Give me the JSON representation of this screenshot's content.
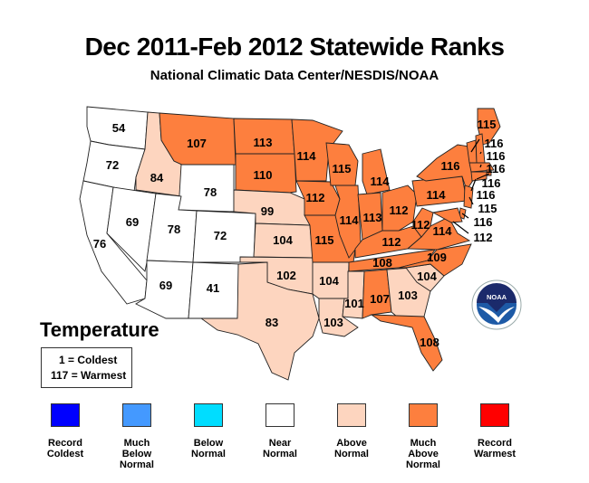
{
  "title": "Dec 2011-Feb 2012 Statewide Ranks",
  "subtitle": "National Climatic Data Center/NESDIS/NOAA",
  "variable_label": "Temperature",
  "key": [
    "1 = Coldest",
    "117 = Warmest"
  ],
  "logo_text": "NOAA",
  "categories": {
    "record_coldest": {
      "label": "Record Coldest",
      "color": "#0000ff"
    },
    "much_below": {
      "label": "Much Below Normal",
      "color": "#4499ff"
    },
    "below": {
      "label": "Below Normal",
      "color": "#00ddff"
    },
    "near": {
      "label": "Near Normal",
      "color": "#ffffff"
    },
    "above": {
      "label": "Above Normal",
      "color": "#fdd5bf"
    },
    "much_above": {
      "label": "Much Above Normal",
      "color": "#fd7f3e"
    },
    "record_warmest": {
      "label": "Record Warmest",
      "color": "#ff0000"
    }
  },
  "legend": [
    {
      "key": "record_coldest",
      "lines": [
        "Record",
        "Coldest"
      ]
    },
    {
      "key": "much_below",
      "lines": [
        "Much",
        "Below",
        "Normal"
      ]
    },
    {
      "key": "below",
      "lines": [
        "Below",
        "Normal"
      ]
    },
    {
      "key": "near",
      "lines": [
        "Near",
        "Normal"
      ]
    },
    {
      "key": "above",
      "lines": [
        "Above",
        "Normal"
      ]
    },
    {
      "key": "much_above",
      "lines": [
        "Much",
        "Above",
        "Normal"
      ]
    },
    {
      "key": "record_warmest",
      "lines": [
        "Record",
        "Warmest"
      ]
    }
  ],
  "states": [
    {
      "state": "WA",
      "rank": 54,
      "category": "near"
    },
    {
      "state": "OR",
      "rank": 72,
      "category": "near"
    },
    {
      "state": "CA",
      "rank": 76,
      "category": "near"
    },
    {
      "state": "ID",
      "rank": 84,
      "category": "above"
    },
    {
      "state": "NV",
      "rank": 69,
      "category": "near"
    },
    {
      "state": "MT",
      "rank": 107,
      "category": "much_above"
    },
    {
      "state": "WY",
      "rank": 78,
      "category": "near"
    },
    {
      "state": "UT",
      "rank": 78,
      "category": "near"
    },
    {
      "state": "AZ",
      "rank": 69,
      "category": "near"
    },
    {
      "state": "CO",
      "rank": 72,
      "category": "near"
    },
    {
      "state": "NM",
      "rank": 41,
      "category": "near"
    },
    {
      "state": "ND",
      "rank": 113,
      "category": "much_above"
    },
    {
      "state": "SD",
      "rank": 110,
      "category": "much_above"
    },
    {
      "state": "NE",
      "rank": 99,
      "category": "above"
    },
    {
      "state": "KS",
      "rank": 104,
      "category": "above"
    },
    {
      "state": "OK",
      "rank": 102,
      "category": "above"
    },
    {
      "state": "TX",
      "rank": 83,
      "category": "above"
    },
    {
      "state": "MN",
      "rank": 114,
      "category": "much_above"
    },
    {
      "state": "IA",
      "rank": 112,
      "category": "much_above"
    },
    {
      "state": "MO",
      "rank": 115,
      "category": "much_above"
    },
    {
      "state": "AR",
      "rank": 104,
      "category": "above"
    },
    {
      "state": "LA",
      "rank": 103,
      "category": "above"
    },
    {
      "state": "WI",
      "rank": 115,
      "category": "much_above"
    },
    {
      "state": "IL",
      "rank": 114,
      "category": "much_above"
    },
    {
      "state": "MI",
      "rank": 114,
      "category": "much_above"
    },
    {
      "state": "IN",
      "rank": 113,
      "category": "much_above"
    },
    {
      "state": "OH",
      "rank": 112,
      "category": "much_above"
    },
    {
      "state": "KY",
      "rank": 112,
      "category": "much_above"
    },
    {
      "state": "TN",
      "rank": 108,
      "category": "much_above"
    },
    {
      "state": "MS",
      "rank": 101,
      "category": "above"
    },
    {
      "state": "AL",
      "rank": 107,
      "category": "much_above"
    },
    {
      "state": "GA",
      "rank": 103,
      "category": "above"
    },
    {
      "state": "FL",
      "rank": 108,
      "category": "much_above"
    },
    {
      "state": "SC",
      "rank": 104,
      "category": "above"
    },
    {
      "state": "NC",
      "rank": 109,
      "category": "much_above"
    },
    {
      "state": "VA",
      "rank": 114,
      "category": "much_above"
    },
    {
      "state": "WV",
      "rank": 112,
      "category": "much_above"
    },
    {
      "state": "PA",
      "rank": 114,
      "category": "much_above"
    },
    {
      "state": "NY",
      "rank": 116,
      "category": "much_above"
    },
    {
      "state": "ME",
      "rank": 115,
      "category": "much_above"
    },
    {
      "state": "VT",
      "rank": 116,
      "category": "much_above"
    },
    {
      "state": "NH",
      "rank": 116,
      "category": "much_above"
    },
    {
      "state": "MA",
      "rank": 116,
      "category": "much_above"
    },
    {
      "state": "RI",
      "rank": 116,
      "category": "much_above"
    },
    {
      "state": "CT",
      "rank": 116,
      "category": "much_above"
    },
    {
      "state": "NJ",
      "rank": 115,
      "category": "much_above"
    },
    {
      "state": "DE",
      "rank": 116,
      "category": "much_above"
    },
    {
      "state": "MD",
      "rank": 112,
      "category": "much_above"
    }
  ]
}
